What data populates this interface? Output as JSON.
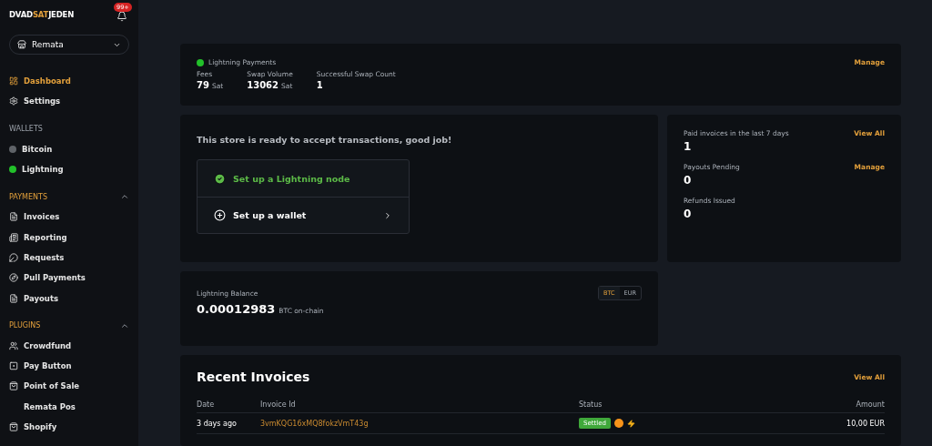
{
  "logo": {
    "parts": [
      "DVAD",
      "SAT",
      "JEDEN"
    ]
  },
  "notifications": {
    "badge": "99+"
  },
  "store_selector": {
    "value": "Remata"
  },
  "nav": [
    {
      "kind": "item",
      "label": "Dashboard",
      "selected": true
    },
    {
      "kind": "item",
      "label": "Settings",
      "selected": false
    },
    {
      "kind": "section",
      "label": "WALLETS",
      "expanded": false,
      "accent": false
    },
    {
      "kind": "wallet",
      "label": "Bitcoin",
      "color": "#5f6368"
    },
    {
      "kind": "wallet",
      "label": "Lightning",
      "color": "#22c02a"
    },
    {
      "kind": "section",
      "label": "PAYMENTS",
      "expanded": true,
      "accent": true
    },
    {
      "kind": "item",
      "label": "Invoices",
      "selected": false
    },
    {
      "kind": "item",
      "label": "Reporting",
      "selected": false
    },
    {
      "kind": "item",
      "label": "Requests",
      "selected": false
    },
    {
      "kind": "item",
      "label": "Pull Payments",
      "selected": false
    },
    {
      "kind": "item",
      "label": "Payouts",
      "selected": false
    },
    {
      "kind": "section",
      "label": "PLUGINS",
      "expanded": true,
      "accent": true
    },
    {
      "kind": "item",
      "label": "Crowdfund",
      "selected": false
    },
    {
      "kind": "item",
      "label": "Pay Button",
      "selected": false
    },
    {
      "kind": "item",
      "label": "Point of Sale",
      "selected": false
    },
    {
      "kind": "subitem",
      "label": "Remata Pos",
      "selected": false
    },
    {
      "kind": "item",
      "label": "Shopify",
      "selected": false
    }
  ],
  "lightning_card": {
    "title": "Lightning Payments",
    "action": "Manage",
    "stats": [
      {
        "label": "Fees",
        "value": "79",
        "unit": "Sat"
      },
      {
        "label": "Swap Volume",
        "value": "13062",
        "unit": "Sat"
      },
      {
        "label": "Successful Swap Count",
        "value": "1"
      }
    ]
  },
  "setup_card": {
    "message": "This store is ready to accept transactions, good job!",
    "steps": [
      {
        "label": "Set up a Lightning node",
        "done": true
      },
      {
        "label": "Set up a wallet",
        "done": false
      }
    ]
  },
  "summary_card": {
    "items": [
      {
        "label": "Paid invoices in the last 7 days",
        "value": "1",
        "action": "View All"
      },
      {
        "label": "Payouts Pending",
        "value": "0",
        "action": "Manage"
      },
      {
        "label": "Refunds Issued",
        "value": "0"
      }
    ]
  },
  "balance_card": {
    "title": "Lightning Balance",
    "amount": "0.00012983",
    "unit": "BTC on-chain",
    "currencies": [
      {
        "label": "BTC",
        "selected": true
      },
      {
        "label": "EUR",
        "selected": false
      }
    ]
  },
  "invoices": {
    "title": "Recent Invoices",
    "action": "View All",
    "columns": [
      "Date",
      "Invoice Id",
      "Status",
      "Amount"
    ],
    "rows": [
      {
        "date": "3 days ago",
        "id": "3vmKQG16xMQ8fokzVmT43g",
        "status": "Settled",
        "amount": "10,00 EUR"
      }
    ]
  }
}
